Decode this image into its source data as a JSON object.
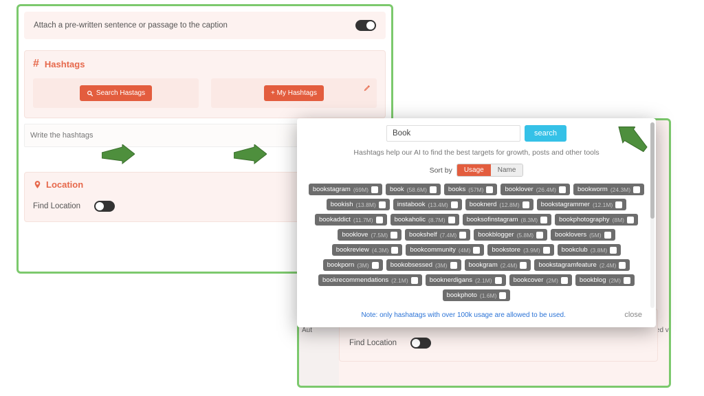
{
  "attach": {
    "label": "Attach a pre-written sentence or passage to the caption",
    "on": true
  },
  "hashtags_section": {
    "title": "Hashtags",
    "search_btn": "Search Hastags",
    "my_btn": "+ My Hashtags",
    "input_placeholder": "Write the hashtags"
  },
  "location_section": {
    "title": "Location",
    "find_label": "Find Location"
  },
  "right_panel": {
    "auto_text": "Aut",
    "rewarded_text": "ewarded vi"
  },
  "modal": {
    "search_value": "Book",
    "search_btn": "search",
    "help_text": "Hashtags help our AI to find the best targets for growth, posts and other tools",
    "sort_label": "Sort by",
    "sort_options": {
      "usage": "Usage",
      "name": "Name"
    },
    "note": "Note: only hashatags with over 100k usage are allowed to be used.",
    "close": "close",
    "tags": [
      {
        "name": "bookstagram",
        "count": "69M"
      },
      {
        "name": "book",
        "count": "58.6M"
      },
      {
        "name": "books",
        "count": "57M"
      },
      {
        "name": "booklover",
        "count": "26.4M"
      },
      {
        "name": "bookworm",
        "count": "24.3M"
      },
      {
        "name": "bookish",
        "count": "13.8M"
      },
      {
        "name": "instabook",
        "count": "13.4M"
      },
      {
        "name": "booknerd",
        "count": "12.8M"
      },
      {
        "name": "bookstagrammer",
        "count": "12.1M"
      },
      {
        "name": "bookaddict",
        "count": "11.7M"
      },
      {
        "name": "bookaholic",
        "count": "8.7M"
      },
      {
        "name": "booksofinstagram",
        "count": "8.3M"
      },
      {
        "name": "bookphotography",
        "count": "8M"
      },
      {
        "name": "booklove",
        "count": "7.5M"
      },
      {
        "name": "bookshelf",
        "count": "7.4M"
      },
      {
        "name": "bookblogger",
        "count": "5.8M"
      },
      {
        "name": "booklovers",
        "count": "5M"
      },
      {
        "name": "bookreview",
        "count": "4.3M"
      },
      {
        "name": "bookcommunity",
        "count": "4M"
      },
      {
        "name": "bookstore",
        "count": "3.9M"
      },
      {
        "name": "bookclub",
        "count": "3.8M"
      },
      {
        "name": "bookporn",
        "count": "3M"
      },
      {
        "name": "bookobsessed",
        "count": "3M"
      },
      {
        "name": "bookgram",
        "count": "2.4M"
      },
      {
        "name": "bookstagramfeature",
        "count": "2.4M"
      },
      {
        "name": "bookrecommendations",
        "count": "2.1M"
      },
      {
        "name": "booknerdigans",
        "count": "2.1M"
      },
      {
        "name": "bookcover",
        "count": "2M"
      },
      {
        "name": "bookblog",
        "count": "2M"
      },
      {
        "name": "bookphoto",
        "count": "1.6M"
      }
    ]
  }
}
